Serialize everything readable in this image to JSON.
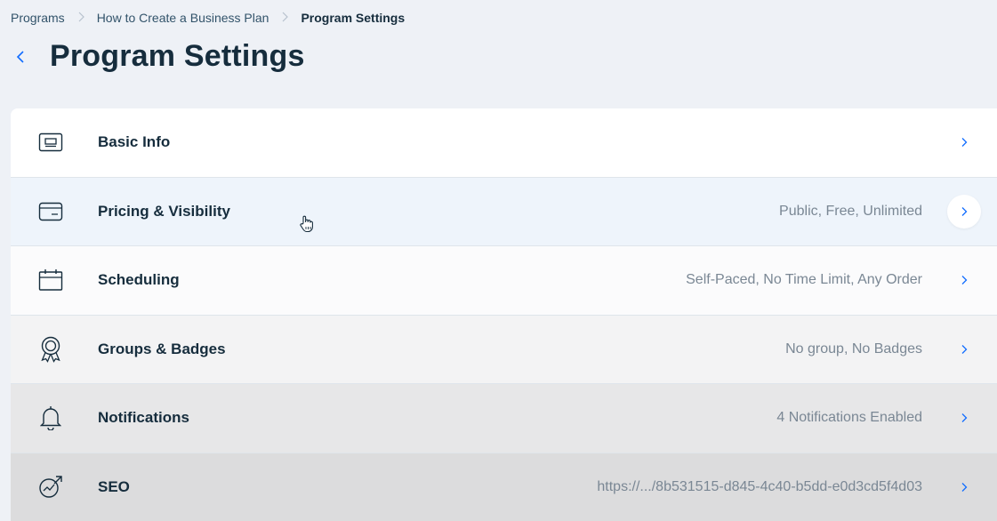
{
  "breadcrumb": {
    "items": [
      "Programs",
      "How to Create a Business Plan",
      "Program Settings"
    ]
  },
  "header": {
    "title": "Program Settings"
  },
  "settings": {
    "rows": [
      {
        "label": "Basic Info",
        "value": "",
        "icon": "display-icon"
      },
      {
        "label": "Pricing & Visibility",
        "value": "Public, Free, Unlimited",
        "icon": "card-icon"
      },
      {
        "label": "Scheduling",
        "value": "Self-Paced, No Time Limit, Any Order",
        "icon": "calendar-icon"
      },
      {
        "label": "Groups & Badges",
        "value": "No group, No Badges",
        "icon": "badge-icon"
      },
      {
        "label": "Notifications",
        "value": "4 Notifications Enabled",
        "icon": "bell-icon"
      },
      {
        "label": "SEO",
        "value": "https://.../8b531515-d845-4c40-b5dd-e0d3cd5f4d03",
        "icon": "seo-icon"
      }
    ]
  },
  "colors": {
    "accent": "#116dff",
    "text": "#162d3d",
    "muted": "#7a8794"
  }
}
